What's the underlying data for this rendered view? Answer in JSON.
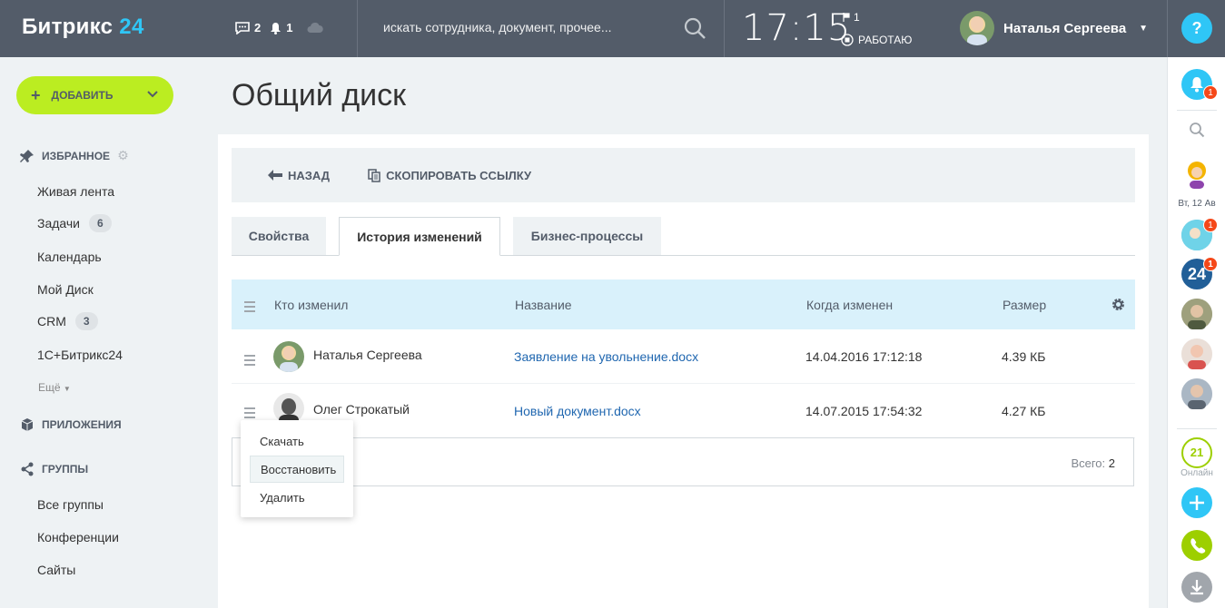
{
  "header": {
    "logo_text": "Битрикс",
    "logo_num": "24",
    "messages_count": "2",
    "notifications_count": "1",
    "search_placeholder": "искать сотрудника, документ, прочее...",
    "time": "17:15",
    "flag_count": "1",
    "work_status": "РАБОТАЮ",
    "user_name": "Наталья Сергеева",
    "help_label": "?"
  },
  "sidebar": {
    "add_label": "ДОБАВИТЬ",
    "favorites_title": "ИЗБРАННОЕ",
    "items": [
      {
        "label": "Живая лента",
        "badge": ""
      },
      {
        "label": "Задачи",
        "badge": "6"
      },
      {
        "label": "Календарь",
        "badge": ""
      },
      {
        "label": "Мой Диск",
        "badge": ""
      },
      {
        "label": "CRM",
        "badge": "3"
      },
      {
        "label": "1С+Битрикс24",
        "badge": ""
      }
    ],
    "more_label": "Ещё",
    "apps_title": "ПРИЛОЖЕНИЯ",
    "groups_title": "ГРУППЫ",
    "group_items": [
      {
        "label": "Все группы"
      },
      {
        "label": "Конференции"
      },
      {
        "label": "Сайты"
      }
    ]
  },
  "main": {
    "title": "Общий диск",
    "toolbar": {
      "back_label": "НАЗАД",
      "copy_link_label": "СКОПИРОВАТЬ ССЫЛКУ"
    },
    "tabs": [
      {
        "label": "Свойства",
        "active": false
      },
      {
        "label": "История изменений",
        "active": true
      },
      {
        "label": "Бизнес-процессы",
        "active": false
      }
    ],
    "grid": {
      "columns": [
        "Кто изменил",
        "Название",
        "Когда изменен",
        "Размер"
      ],
      "rows": [
        {
          "user": "Наталья Сергеева",
          "name": "Заявление на увольнение.docx",
          "date": "14.04.2016 17:12:18",
          "size": "4.39 КБ"
        },
        {
          "user": "Олег Строкатый",
          "name": "Новый документ.docx",
          "date": "14.07.2015 17:54:32",
          "size": "4.27 КБ"
        }
      ],
      "total_label": "Всего:",
      "total_value": "2"
    },
    "context_menu": {
      "items": [
        "Скачать",
        "Восстановить",
        "Удалить"
      ]
    }
  },
  "rightbar": {
    "notif_badge": "1",
    "date_label": "Вт, 12 Ав",
    "chat_badge_1": "1",
    "chat_badge_2": "1",
    "b24_label": "24",
    "online_count": "21",
    "online_label": "Онлайн"
  },
  "colors": {
    "header_bg": "#535c69",
    "accent": "#2fc6f6",
    "add_button": "#bbed21",
    "link": "#2067b0",
    "grid_header_bg": "#d9f1fb",
    "badge_red": "#f54819",
    "phone_green": "#9dcf00"
  }
}
